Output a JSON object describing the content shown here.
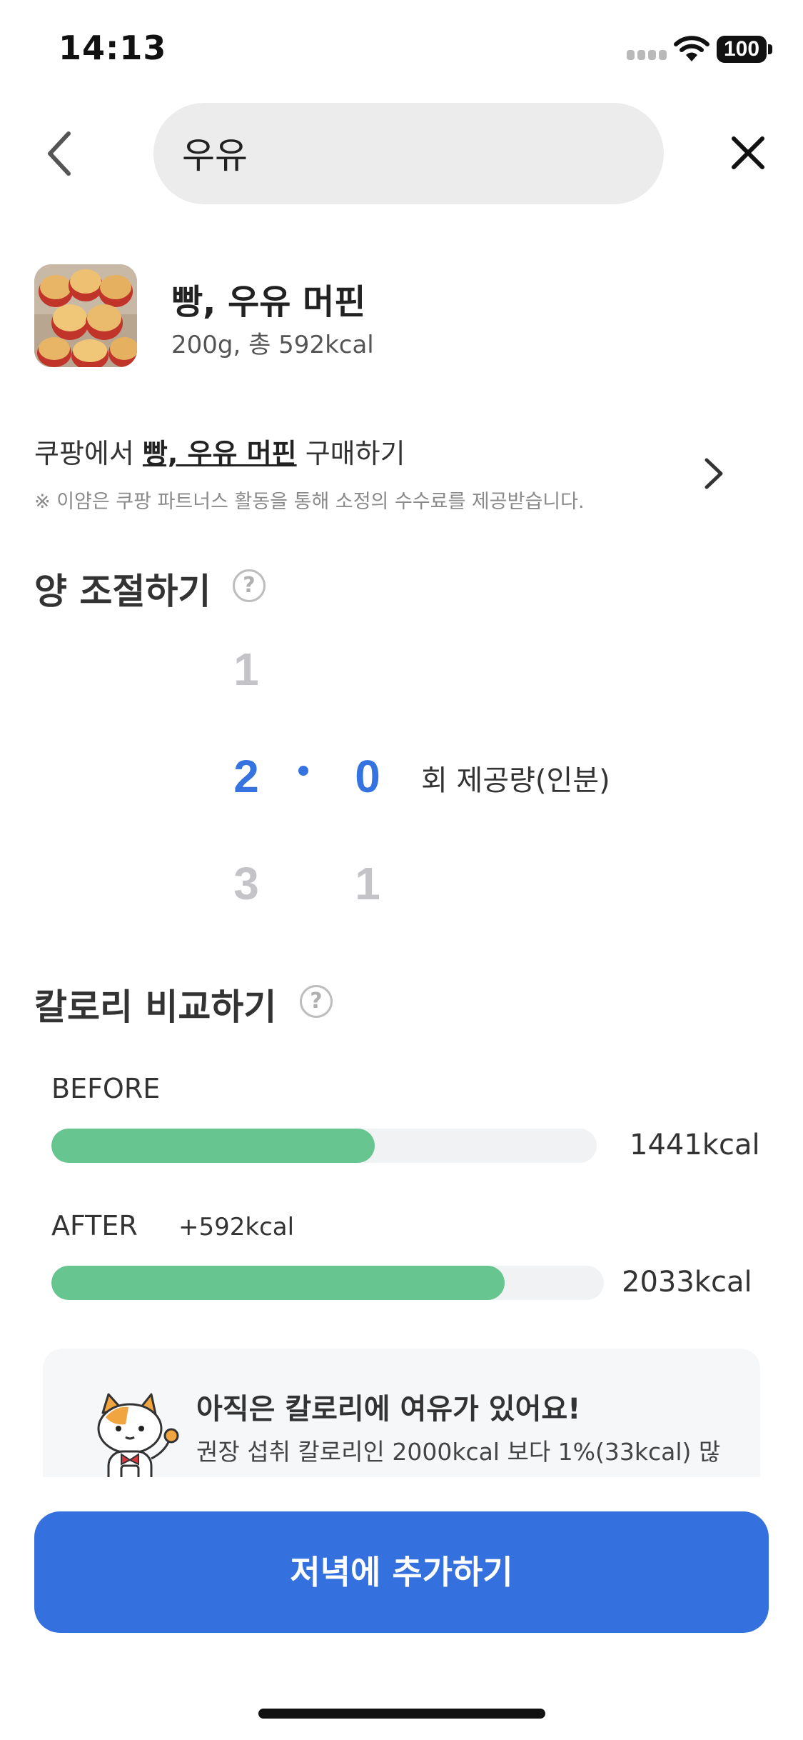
{
  "status_bar": {
    "time": "14:13",
    "battery": "100"
  },
  "header": {
    "search_value": "우유",
    "back_icon": "chevron-left-icon",
    "close_icon": "close-icon"
  },
  "food": {
    "name": "빵, 우유 머핀",
    "detail": "200g, 총 592kcal",
    "image": "muffin-photo"
  },
  "coupang": {
    "prefix": "쿠팡에서 ",
    "product": "빵, 우유 머핀",
    "suffix": " 구매하기",
    "note": "※ 이얌은 쿠팡 파트너스 활동을 통해 소정의 수수료를 제공받습니다."
  },
  "portion": {
    "title": "양 조절하기",
    "help": "?",
    "integer_prev": "1",
    "integer_selected": "2",
    "integer_next": "3",
    "decimal_selected": "0",
    "decimal_next": "1",
    "separator": ".",
    "unit": "회 제공량(인분)"
  },
  "calorie_compare": {
    "title": "칼로리 비교하기",
    "help": "?",
    "before": {
      "label": "BEFORE",
      "value_text": "1441kcal",
      "fill_fraction": 0.593
    },
    "after": {
      "label": "AFTER",
      "delta": "+592kcal",
      "value_text": "2033kcal",
      "fill_fraction": 0.82
    }
  },
  "info_card": {
    "title": "아직은 칼로리에 여유가 있어요!",
    "description": "권장 섭취 칼로리인 2000kcal 보다 1%(33kcal) 많",
    "icon": "cat-mascot-icon"
  },
  "action": {
    "add_label": "저녁에 추가하기"
  },
  "colors": {
    "accent": "#3571de",
    "bar_fill": "#67c68f",
    "bar_track": "#f1f2f4"
  }
}
